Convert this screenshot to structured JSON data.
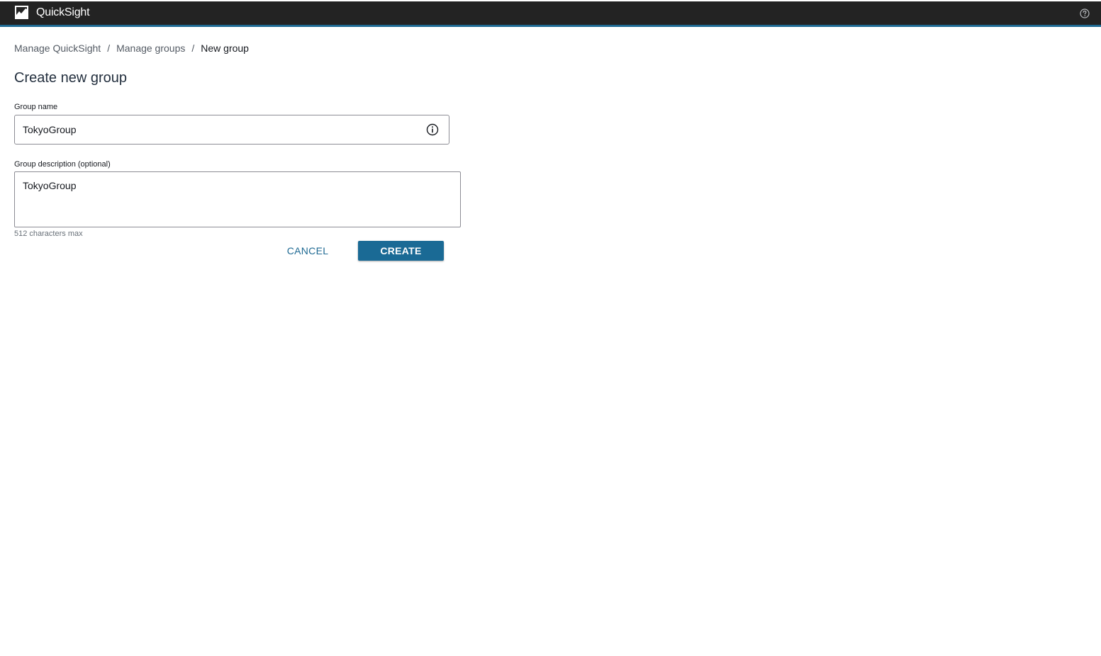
{
  "app": {
    "name": "QuickSight",
    "logo_icon": "quicksight-chart-icon",
    "help_icon": "help-circle-icon",
    "header_bg": "#232323",
    "accent": "#1f6a93"
  },
  "breadcrumb": {
    "items": [
      "Manage QuickSight",
      "Manage groups"
    ],
    "separator": "/",
    "current": "New group"
  },
  "page": {
    "title": "Create new group"
  },
  "form": {
    "group_name": {
      "label": "Group name",
      "value": "TokyoGroup",
      "info_icon": "info-circle-icon"
    },
    "group_description": {
      "label": "Group description (optional)",
      "value": "TokyoGroup",
      "hint": "512 characters max"
    },
    "actions": {
      "cancel_label": "CANCEL",
      "create_label": "CREATE",
      "create_color": "#1a6a95"
    }
  }
}
